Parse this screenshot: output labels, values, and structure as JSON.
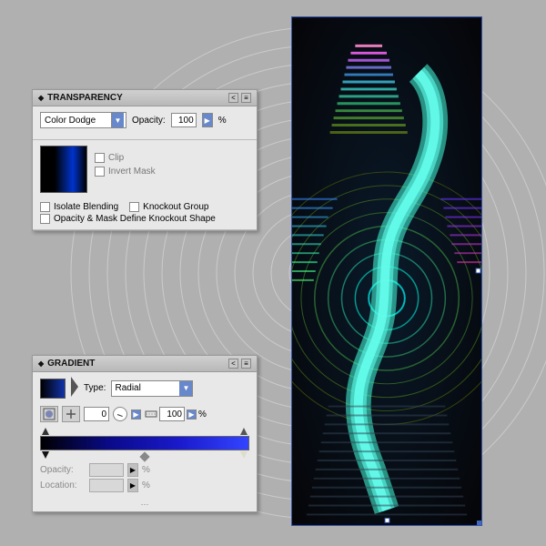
{
  "canvas": {
    "background": "#b5b5b5"
  },
  "transparency_panel": {
    "title": "TRANSPARENCY",
    "blend_mode": "Color Dodge",
    "opacity_label": "Opacity:",
    "opacity_value": "100",
    "clip_label": "Clip",
    "invert_mask_label": "Invert Mask",
    "isolate_blending_label": "Isolate Blending",
    "knockout_group_label": "Knockout Group",
    "opacity_mask_label": "Opacity & Mask Define Knockout Shape",
    "collapse_btn": "<",
    "menu_btn": "≡"
  },
  "gradient_panel": {
    "title": "GRADIENT",
    "type_label": "Type:",
    "type_value": "Radial",
    "angle_value": "0",
    "scale_value": "100",
    "scale_pct": "%",
    "opacity_label": "Opacity:",
    "location_label": "Location:",
    "opacity_pct": "%",
    "location_pct": "%"
  }
}
